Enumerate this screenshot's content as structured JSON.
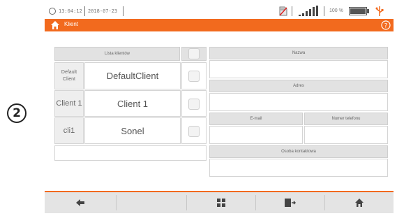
{
  "callout": {
    "label": "2"
  },
  "status_bar": {
    "time": "13:04:12",
    "date": "2018-07-23",
    "battery_percent": "100 %"
  },
  "title_bar": {
    "title": "Klient"
  },
  "client_table": {
    "header_label": "Lista klientów",
    "rows": [
      {
        "id": "Default Client",
        "name": "DefaultClient"
      },
      {
        "id": "Client 1",
        "name": "Client 1"
      },
      {
        "id": "cli1",
        "name": "Sonel"
      }
    ]
  },
  "details_form": {
    "name_label": "Nazwa",
    "address_label": "Adres",
    "email_label": "E-mail",
    "phone_label": "Numer telefonu",
    "contact_person_label": "Osoba kontaktowa"
  },
  "colors": {
    "accent": "#f26a1e",
    "header_gray": "#e2e2e2",
    "bar_gray": "#e4e4e4"
  },
  "icons": {
    "status": [
      "clock-icon",
      "sd-card-icon",
      "signal-icon",
      "battery-icon",
      "usb-icon"
    ],
    "title": [
      "home-icon",
      "help-icon"
    ],
    "bottom": [
      "back-arrow-icon",
      "grid-icon",
      "export-icon",
      "home-icon"
    ]
  }
}
